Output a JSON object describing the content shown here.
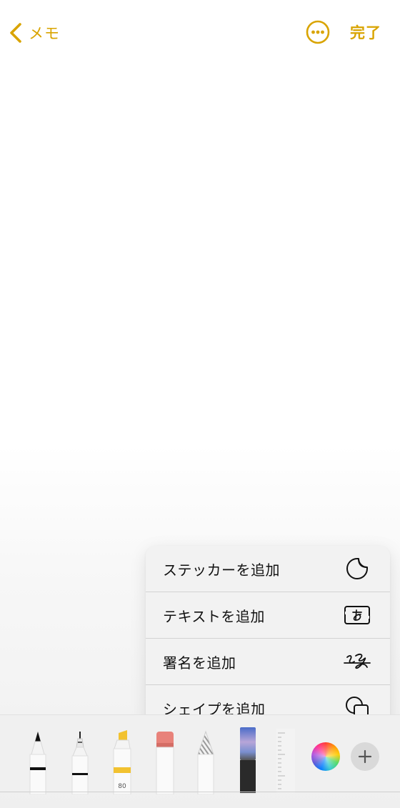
{
  "nav": {
    "back_label": "メモ",
    "back_icon": "chevron-left-icon",
    "more_icon": "ellipsis-circle-icon",
    "done_label": "完了"
  },
  "menu": {
    "items": [
      {
        "label": "ステッカーを追加",
        "icon": "sticker-icon"
      },
      {
        "label": "テキストを追加",
        "icon": "text-box-icon"
      },
      {
        "label": "署名を追加",
        "icon": "signature-icon"
      },
      {
        "label": "シェイプを追加",
        "icon": "shapes-icon"
      }
    ]
  },
  "palette": {
    "tools": [
      {
        "name": "pen",
        "icon": "pen-icon"
      },
      {
        "name": "monoline",
        "icon": "monoline-icon"
      },
      {
        "name": "highlighter",
        "icon": "highlighter-icon",
        "label": "80"
      },
      {
        "name": "eraser",
        "icon": "eraser-icon"
      },
      {
        "name": "pencil",
        "icon": "pencil-icon"
      },
      {
        "name": "lasso",
        "icon": "lasso-icon"
      },
      {
        "name": "ruler",
        "icon": "ruler-icon"
      }
    ],
    "color_picker_icon": "color-wheel-icon",
    "add_icon": "plus-icon"
  },
  "colors": {
    "accent": "#d9a400",
    "menu_bg": "#f2f2f2",
    "highlighter": "#f2c230",
    "eraser": "#e8827a"
  }
}
